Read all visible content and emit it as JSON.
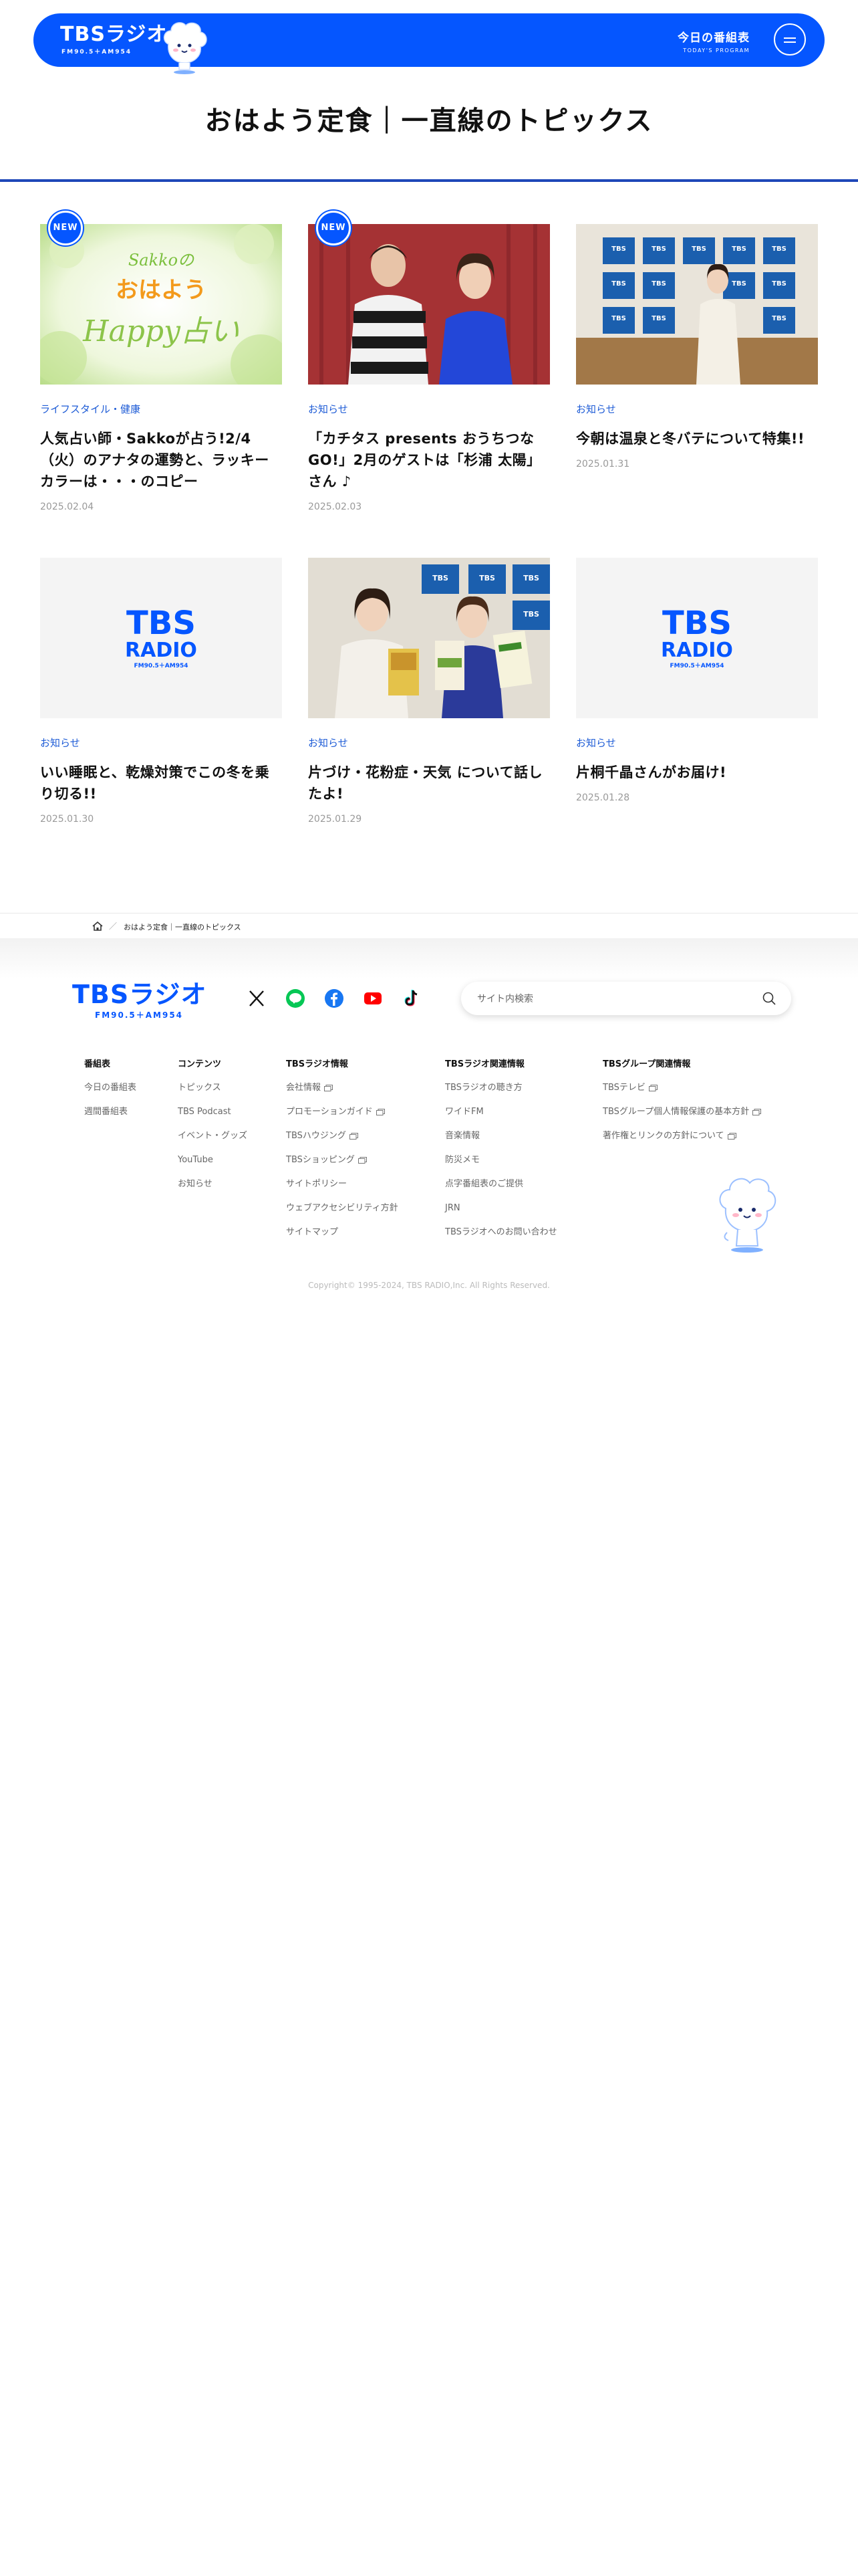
{
  "header": {
    "logo_main": "TBSラジオ",
    "logo_sub": "FM90.5＋AM954",
    "today_main": "今日の番組表",
    "today_sub": "TODAY'S PROGRAM"
  },
  "page_title": "おはよう定食｜一直線のトピックス",
  "new_label": "NEW",
  "thumb_text": {
    "sakko": "Sakkoの",
    "ohayou": "おはよう",
    "happy": "Happy占い",
    "tbs": "TBS",
    "radio": "RADIO",
    "freq": "FM90.5＋AM954"
  },
  "articles": [
    {
      "category": "ライフスタイル・健康",
      "title": "人気占い師・Sakkoが占う!2/4（火）のアナタの運勢と、ラッキーカラーは・・・のコピー",
      "date": "2025.02.04",
      "is_new": true
    },
    {
      "category": "お知らせ",
      "title": "「カチタス presents おうちつなGO!」2月のゲストは「杉浦 太陽」さん ♪",
      "date": "2025.02.03",
      "is_new": true
    },
    {
      "category": "お知らせ",
      "title": "今朝は温泉と冬バテについて特集!!",
      "date": "2025.01.31",
      "is_new": false
    },
    {
      "category": "お知らせ",
      "title": "いい睡眠と、乾燥対策でこの冬を乗り切る!!",
      "date": "2025.01.30",
      "is_new": false
    },
    {
      "category": "お知らせ",
      "title": "片づけ・花粉症・天気 について話したよ!",
      "date": "2025.01.29",
      "is_new": false
    },
    {
      "category": "お知らせ",
      "title": "片桐千晶さんがお届け!",
      "date": "2025.01.28",
      "is_new": false
    }
  ],
  "breadcrumb": {
    "current": "おはよう定食｜一直線のトピックス"
  },
  "footer": {
    "logo_main": "TBSラジオ",
    "logo_sub": "FM90.5＋AM954",
    "search_placeholder": "サイト内検索",
    "social_icons": [
      "x-icon",
      "line-icon",
      "facebook-icon",
      "youtube-icon",
      "tiktok-icon"
    ],
    "columns": [
      {
        "heading": "番組表",
        "links": [
          {
            "label": "今日の番組表"
          },
          {
            "label": "週間番組表"
          }
        ]
      },
      {
        "heading": "コンテンツ",
        "links": [
          {
            "label": "トピックス"
          },
          {
            "label": "TBS Podcast"
          },
          {
            "label": "イベント・グッズ"
          },
          {
            "label": "YouTube"
          },
          {
            "label": "お知らせ"
          }
        ]
      },
      {
        "heading": "TBSラジオ情報",
        "links": [
          {
            "label": "会社情報",
            "external": true
          },
          {
            "label": "プロモーションガイド",
            "external": true
          },
          {
            "label": "TBSハウジング",
            "external": true
          },
          {
            "label": "TBSショッピング",
            "external": true
          },
          {
            "label": "サイトポリシー"
          },
          {
            "label": "ウェブアクセシビリティ方針"
          },
          {
            "label": "サイトマップ"
          }
        ]
      },
      {
        "heading": "TBSラジオ関連情報",
        "links": [
          {
            "label": "TBSラジオの聴き方"
          },
          {
            "label": "ワイドFM"
          },
          {
            "label": "音楽情報"
          },
          {
            "label": "防災メモ"
          },
          {
            "label": "点字番組表のご提供"
          },
          {
            "label": "JRN"
          },
          {
            "label": "TBSラジオへのお問い合わせ"
          }
        ]
      },
      {
        "heading": "TBSグループ関連情報",
        "links": [
          {
            "label": "TBSテレビ",
            "external": true
          },
          {
            "label": "TBSグループ個人情報保護の基本方針",
            "external": true
          },
          {
            "label": "著作権とリンクの方針について",
            "external": true
          }
        ]
      }
    ],
    "copyright": "Copyright© 1995-2024, TBS RADIO,Inc. All Rights Reserved."
  },
  "colors": {
    "brand_blue": "#0556ff",
    "category_blue": "#1d5bd6",
    "rule_blue": "#1e47b8"
  }
}
